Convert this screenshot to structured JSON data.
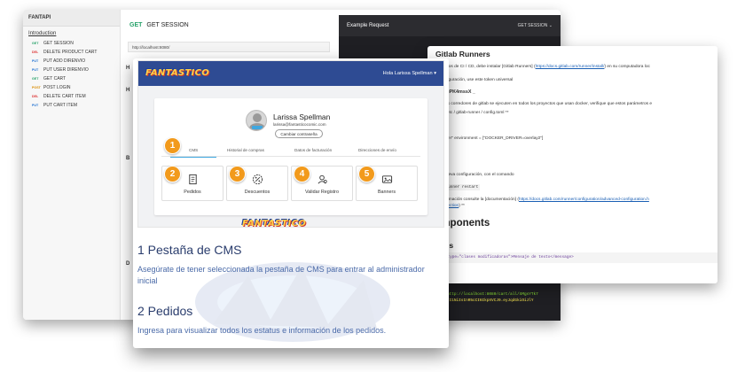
{
  "api_docs": {
    "brand": "FANTAPI",
    "intro_link": "Introduction",
    "endpoints": [
      {
        "method": "GET",
        "label": "GET SESSION"
      },
      {
        "method": "DEL",
        "label": "DELETE PRODUCT CART"
      },
      {
        "method": "PUT",
        "label": "PUT ADD DIRENVIO"
      },
      {
        "method": "PUT",
        "label": "PUT USER DIRENVIO"
      },
      {
        "method": "GET",
        "label": "GET CART"
      },
      {
        "method": "POST",
        "label": "POST LOGIN"
      },
      {
        "method": "DEL",
        "label": "DELETE CART ITEM"
      },
      {
        "method": "PUT",
        "label": "PUT CART ITEM"
      }
    ],
    "title_method": "GET",
    "title": "GET SESSION",
    "url": "http://localhost:8080/",
    "edge_letters": [
      "H",
      "H",
      "B",
      "D"
    ],
    "example": {
      "title": "Example Request",
      "selector": "GET SESSION",
      "code": "curl"
    }
  },
  "gitlab": {
    "title": "Gitlab Runners",
    "lines": [
      {
        "pre": "r los registros de CI / CD, debe instalar [Gitlab Runners] (",
        "link": "https://docs.gitlab.com/runner/install/",
        "post": ") en su computadora loc"
      },
      {
        "pre": "ara la configuración, use este token universal",
        "link": "",
        "post": ""
      },
      {
        "pre": "",
        "link": "",
        "post": ""
      },
      {
        "pre": "ara que sus corredores de gitlab se ejecuten en todos los proyectos que usan docker, verifique que estos parámetros e",
        "link": "",
        "post": ""
      },
      {
        "pre": "rchivo ** / etc / gitlab-runner / config.toml **",
        "link": "",
        "post": ""
      },
      {
        "pre": "ners ]]",
        "link": "",
        "post": ""
      },
      {
        "pre": "tor = \"docker\" environment = [\"DOCKER_DRIVER=overlay2\"]",
        "link": "",
        "post": ""
      },
      {
        "pre": "ers.docker]",
        "link": "",
        "post": ""
      },
      {
        "pre": "ged = true",
        "link": "",
        "post": ""
      },
      {
        "pre": "alidar la nueva configuración, con el comando",
        "link": "",
        "post": ""
      },
      {
        "pre": "a más información consulte la [documentación] (",
        "link": "https://docs.gitlab.com/runner/configuration/advanced-configuration.h",
        "post": ""
      },
      {
        "pre": "",
        "link": "s-docker-section",
        "post": ") **"
      }
    ],
    "token": "px2SAMgPK4mssX _",
    "command": "gitlab-runner restart",
    "h2": "Components",
    "h3": "ssages",
    "codeblock": "essage type=\"clases modificadoras\">Mensaje de texto</message>",
    "dark_code_1": "http://localhost:8080/cart/all/XMgsYTk7",
    "dark_code_2": "zI1NiIsInR5cCI6IkpXVCJ9.eyJqdGkiOiJlY"
  },
  "cms": {
    "header_user": "Hola Larissa Spellman ▾",
    "profile_name": "Larissa Spellman",
    "profile_email": "larissa@fantasticocomic.com",
    "change_password": "Cambiar contraseña",
    "tabs": [
      "CMS",
      "Historial de compras",
      "Datos de facturación",
      "Direcciones de envío"
    ],
    "features": [
      {
        "number": "2",
        "label": "Pedidos",
        "icon": "receipt-icon"
      },
      {
        "number": "3",
        "label": "Descuentos",
        "icon": "discount-icon"
      },
      {
        "number": "4",
        "label": "Validar Registro",
        "icon": "user-search-icon"
      },
      {
        "number": "5",
        "label": "Banners",
        "icon": "image-icon"
      }
    ],
    "tab_badge": "1",
    "logo": "FANTASTICO",
    "sections": [
      {
        "title": "1 Pestaña de CMS",
        "text": "Asegúrate de tener seleccionada la pestaña de CMS para entrar al administrador inicial"
      },
      {
        "title": "2 Pedidos",
        "text": "Ingresa para visualizar todos los estatus e información de los pedidos."
      }
    ]
  },
  "colors": {
    "header_blue": "#2e4b93",
    "badge_orange": "#f29a1c",
    "heading_navy": "#2a3d6d",
    "text_blue": "#4a6aa8"
  }
}
